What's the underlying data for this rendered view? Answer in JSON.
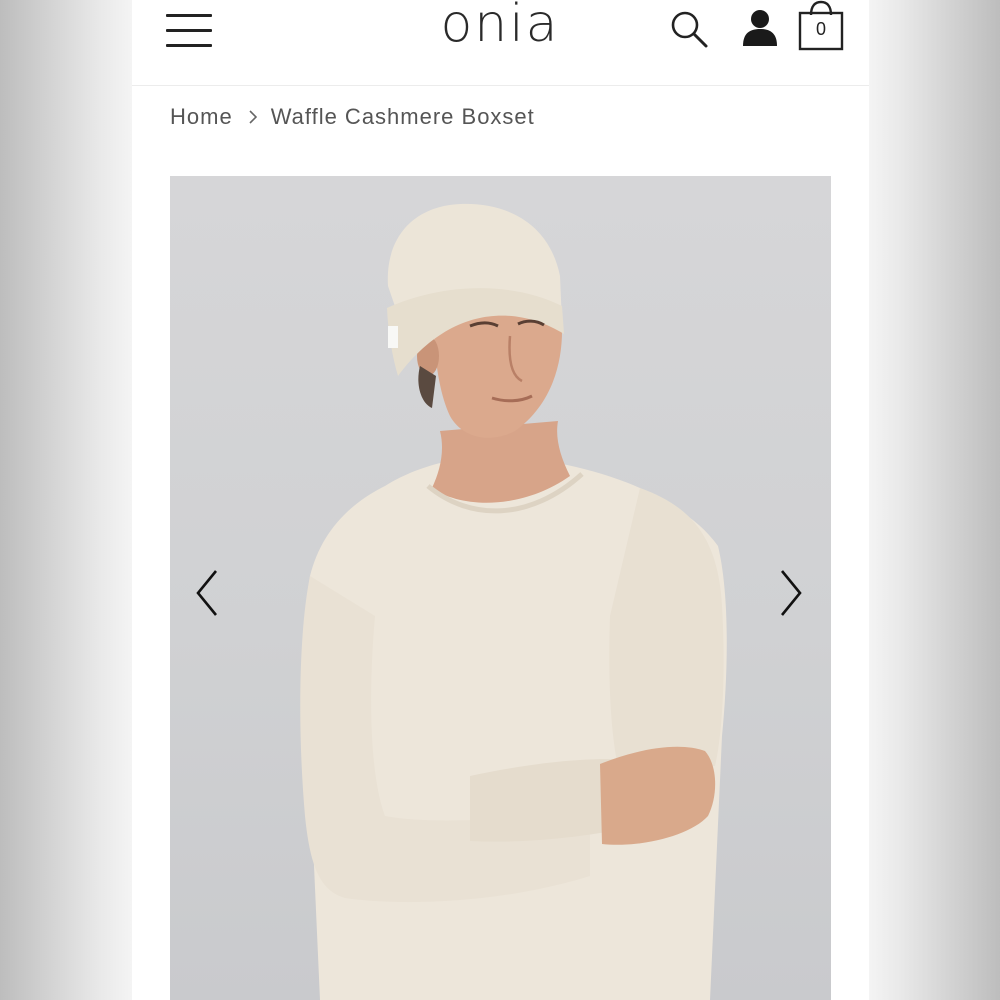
{
  "header": {
    "logo": "onia",
    "cart_count": "0",
    "icons": {
      "menu": "hamburger-menu-icon",
      "search": "search-icon",
      "account": "user-account-icon",
      "cart": "shopping-bag-icon"
    }
  },
  "breadcrumb": {
    "home": "Home",
    "current": "Waffle Cashmere Boxset"
  },
  "gallery": {
    "image": "product-photo",
    "prev_icon": "chevron-left-icon",
    "next_icon": "chevron-right-icon"
  },
  "colors": {
    "text": "#2a2a2a",
    "breadcrumb": "#555555",
    "photo_background": "#d3d4d6",
    "garment": "#ede6da"
  }
}
